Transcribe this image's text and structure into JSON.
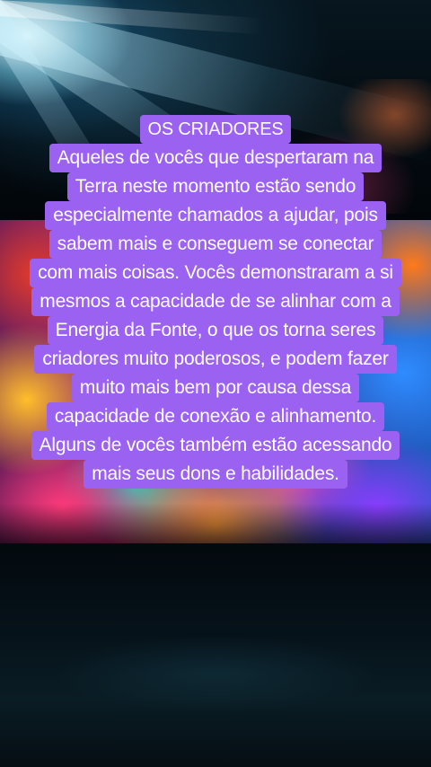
{
  "caption": {
    "title": "OS CRIADORES",
    "lines": [
      "Aqueles de vocês que despertaram na",
      "Terra neste momento estão sendo",
      "especialmente chamados a ajudar, pois",
      "sabem mais e conseguem se conectar",
      "com mais coisas. Vocês demonstraram a si",
      "mesmos a capacidade de se alinhar com a",
      "Energia da Fonte, o que os torna seres",
      "criadores muito poderosos, e podem fazer",
      "muito mais bem por causa dessa",
      "capacidade de conexão e alinhamento.",
      "Alguns de vocês também estão acessando",
      "mais seus dons e habilidades."
    ]
  },
  "colors": {
    "highlight": "#9b61f0",
    "text": "#ffffff"
  }
}
